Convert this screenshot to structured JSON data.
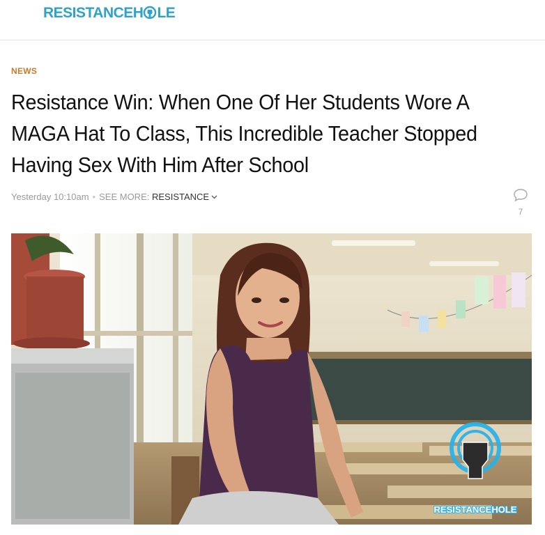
{
  "site": {
    "logo_text_left": "RESISTANCEH",
    "logo_text_right": "LE",
    "brand_color": "#2ea3c7"
  },
  "article": {
    "category": "NEWS",
    "headline": "Resistance Win: When One Of Her Students Wore A MAGA Hat To Class, This Incredible Teacher Stopped Having Sex With Him After School",
    "timestamp": "Yesterday 10:10am",
    "see_more_label": "SEE MORE:",
    "tag": "RESISTANCE",
    "comment_count": "7"
  },
  "image": {
    "watermark_text": "RESISTANCEHOLE"
  },
  "icons": [
    "fist-icon",
    "chevron-down-icon",
    "comment-bubble-icon"
  ]
}
